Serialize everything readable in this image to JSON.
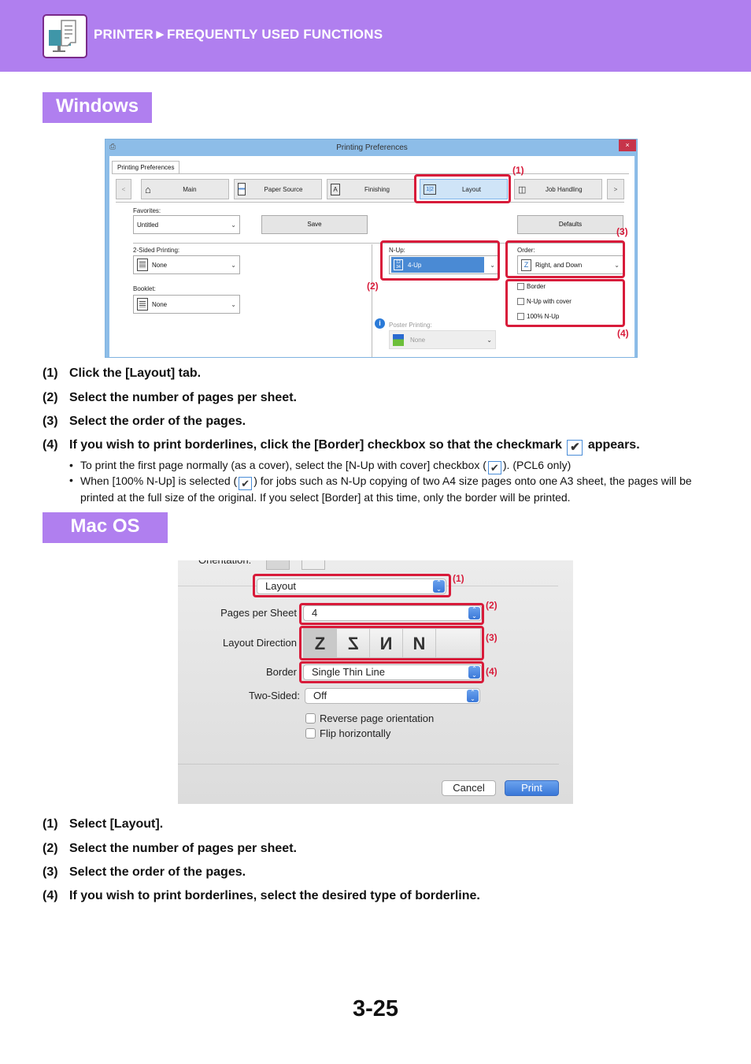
{
  "header": {
    "title": "PRINTER►FREQUENTLY USED FUNCTIONS",
    "icon": "printer-monitor-icon"
  },
  "sections": {
    "windows_label": "Windows",
    "mac_label": "Mac OS"
  },
  "windows_dialog": {
    "title": "Printing Preferences",
    "close_label": "×",
    "tab_label": "Printing Preferences",
    "nav_prev": "<",
    "nav_next": ">",
    "tabs": [
      {
        "label": "Main",
        "icon": "home-icon"
      },
      {
        "label": "Paper Source",
        "icon": "paper-tray-icon"
      },
      {
        "label": "Finishing",
        "icon": "finishing-icon"
      },
      {
        "label": "Layout",
        "icon": "layout-icon",
        "active": true
      },
      {
        "label": "Job Handling",
        "icon": "job-handling-icon"
      }
    ],
    "favorites_label": "Favorites:",
    "favorites_value": "Untitled",
    "save_label": "Save",
    "defaults_label": "Defaults",
    "two_sided_label": "2-Sided Printing:",
    "two_sided_value": "None",
    "booklet_label": "Booklet:",
    "booklet_value": "None",
    "nup_label": "N-Up:",
    "nup_value": "4-Up",
    "poster_label": "Poster Printing:",
    "poster_value": "None",
    "order_label": "Order:",
    "order_value": "Right, and Down",
    "checkboxes": [
      {
        "label": "Border",
        "checked": false
      },
      {
        "label": "N-Up with cover",
        "checked": false
      },
      {
        "label": "100% N-Up",
        "checked": false
      }
    ],
    "callouts": [
      "(1)",
      "(2)",
      "(3)",
      "(4)"
    ]
  },
  "windows_steps": [
    {
      "num": "(1)",
      "text": "Click the [Layout] tab."
    },
    {
      "num": "(2)",
      "text": "Select the number of pages per sheet."
    },
    {
      "num": "(3)",
      "text": "Select the order of the pages."
    },
    {
      "num": "(4)",
      "text_before": "If you wish to print borderlines, click the [Border] checkbox so that the checkmark",
      "text_after": "appears."
    }
  ],
  "windows_bullets": [
    {
      "before": "To print the first page normally (as a cover), select the [N-Up with cover] checkbox (",
      "after": "). (PCL6 only)"
    },
    {
      "before": "When [100% N-Up] is selected (",
      "after": ") for jobs such as N-Up copying of two A4 size pages onto one A3 sheet, the pages will be",
      "line2": "printed at the full size of the original. If you select [Border] at this time, only the border will be printed."
    }
  ],
  "mac_dialog": {
    "orientation_label": "Orientation:",
    "panel_value": "Layout",
    "pages_per_sheet_label": "Pages per Sheet",
    "pages_per_sheet_value": "4",
    "layout_direction_label": "Layout Direction",
    "directions": [
      "Z",
      "S",
      "N-reverse",
      "N"
    ],
    "border_label": "Border",
    "border_value": "Single Thin Line",
    "two_sided_label": "Two-Sided:",
    "two_sided_value": "Off",
    "checkboxes": [
      {
        "label": "Reverse page orientation",
        "checked": false
      },
      {
        "label": "Flip horizontally",
        "checked": false
      }
    ],
    "cancel_label": "Cancel",
    "print_label": "Print",
    "callouts": [
      "(1)",
      "(2)",
      "(3)",
      "(4)"
    ]
  },
  "mac_steps": [
    {
      "num": "(1)",
      "text": "Select [Layout]."
    },
    {
      "num": "(2)",
      "text": "Select the number of pages per sheet."
    },
    {
      "num": "(3)",
      "text": "Select the order of the pages."
    },
    {
      "num": "(4)",
      "text": "If you wish to print borderlines, select the desired type of borderline."
    }
  ],
  "page_number": "3-25",
  "colors": {
    "brand_purple": "#b07fef",
    "callout_red": "#d81b3a",
    "win_titlebar": "#8dbde8",
    "mac_accent": "#3a78d8"
  }
}
